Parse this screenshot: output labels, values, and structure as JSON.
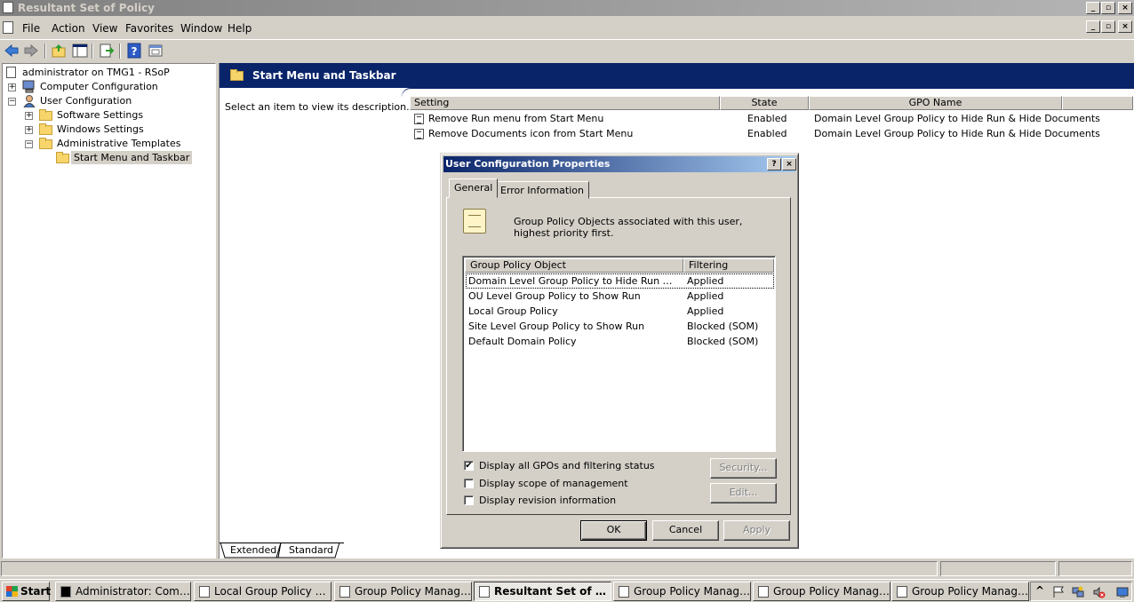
{
  "window": {
    "title": "Resultant Set of Policy",
    "controls": [
      "_",
      "▫",
      "×"
    ]
  },
  "menu": [
    "File",
    "Action",
    "View",
    "Favorites",
    "Window",
    "Help"
  ],
  "toolbar": {
    "icons": [
      "back-icon",
      "forward-icon",
      "up-folder-icon",
      "show-hide-tree-icon",
      "export-list-icon",
      "help-icon",
      "properties-icon"
    ]
  },
  "tree": {
    "root": "administrator on TMG1 - RSoP",
    "items": [
      {
        "label": "Computer Configuration",
        "expander": "+"
      },
      {
        "label": "User Configuration",
        "expander": "−"
      },
      {
        "label": "Software Settings",
        "expander": "+"
      },
      {
        "label": "Windows Settings",
        "expander": "+"
      },
      {
        "label": "Administrative Templates",
        "expander": "−"
      },
      {
        "label": "Start Menu and Taskbar",
        "expander": ""
      }
    ]
  },
  "right": {
    "header": "Start Menu and Taskbar",
    "description": "Select an item to view its description.",
    "columns": [
      "Setting",
      "State",
      "GPO Name"
    ],
    "rows": [
      {
        "setting": "Remove Run menu from Start Menu",
        "state": "Enabled",
        "gpo": "Domain Level Group Policy to Hide Run & Hide Documents"
      },
      {
        "setting": "Remove Documents icon from Start Menu",
        "state": "Enabled",
        "gpo": "Domain Level Group Policy to Hide Run & Hide Documents"
      }
    ],
    "tabs": [
      "Extended",
      "Standard"
    ]
  },
  "dialog": {
    "title": "User Configuration Properties",
    "title_buttons": [
      "?",
      "×"
    ],
    "tabs": [
      "General",
      "Error Information"
    ],
    "intro": "Group Policy Objects associated with this user, highest priority first.",
    "list": {
      "columns": [
        "Group Policy Object",
        "Filtering"
      ],
      "rows": [
        {
          "gpo": "Domain Level Group Policy to Hide Run & Hide Documents",
          "filtering": "Applied"
        },
        {
          "gpo": "OU Level Group Policy to Show Run",
          "filtering": "Applied"
        },
        {
          "gpo": "Local Group Policy",
          "filtering": "Applied"
        },
        {
          "gpo": "Site Level Group Policy to Show Run",
          "filtering": "Blocked (SOM)"
        },
        {
          "gpo": "Default Domain Policy",
          "filtering": "Blocked (SOM)"
        }
      ]
    },
    "checkboxes": [
      {
        "label": "Display all GPOs and filtering status",
        "checked": "✔"
      },
      {
        "label": "Display scope of management",
        "checked": ""
      },
      {
        "label": "Display revision information",
        "checked": ""
      }
    ],
    "side_buttons": [
      "Security...",
      "Edit..."
    ],
    "buttons": [
      "OK",
      "Cancel",
      "Apply"
    ]
  },
  "taskbar": {
    "start": "Start",
    "tasks": [
      "Administrator: Comman...",
      "Local Group Policy Editor",
      "Group Policy Management",
      "Resultant Set of Poli...",
      "Group Policy Manageme...",
      "Group Policy Manageme...",
      "Group Policy Manageme..."
    ],
    "tray": {
      "chevron": "^"
    }
  },
  "colors": {
    "accent": "#0a246a",
    "face": "#d4d0c8"
  }
}
